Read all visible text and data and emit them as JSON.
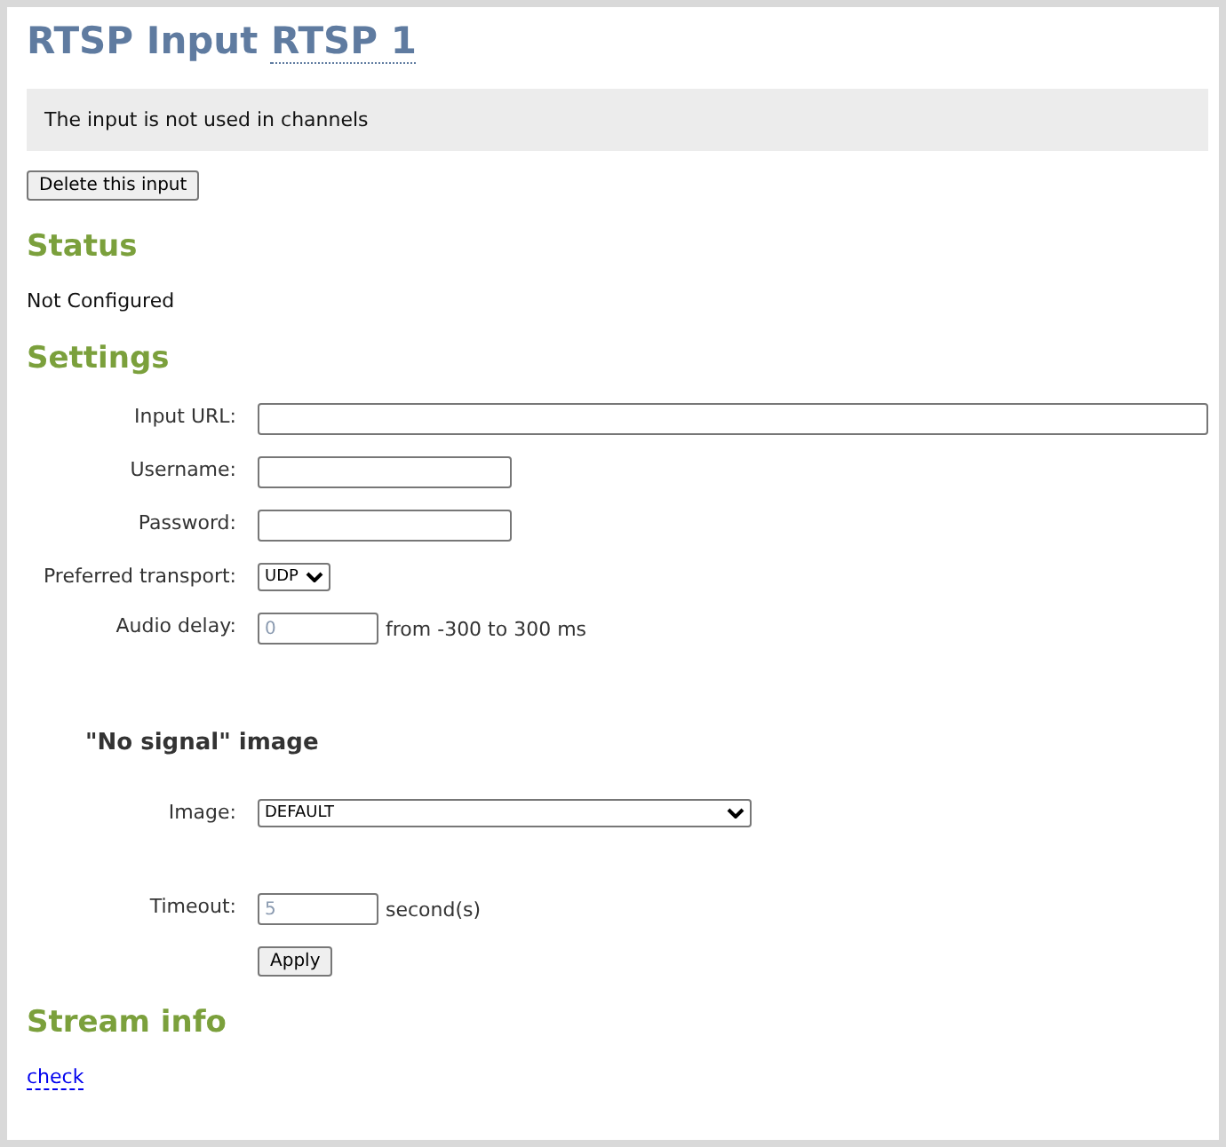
{
  "title": {
    "text": "RTSP Input",
    "name": "RTSP 1"
  },
  "notice": "The input is not used in channels",
  "delete_button": "Delete this input",
  "status": {
    "heading": "Status",
    "value": "Not Configured"
  },
  "settings": {
    "heading": "Settings",
    "fields": [
      {
        "kind": "text",
        "label": "Input URL:"
      },
      {
        "kind": "text",
        "label": "Username:"
      },
      {
        "kind": "password",
        "label": "Password:"
      },
      {
        "kind": "select",
        "label": "Preferred transport:",
        "value": "UDP"
      },
      {
        "kind": "text",
        "label": "Audio delay:",
        "placeholder": "0",
        "suffix": "from -300 to 300 ms"
      }
    ]
  },
  "no_signal": {
    "heading": "\"No signal\" image",
    "fields": [
      {
        "kind": "select",
        "label": "Image:",
        "value": "DEFAULT"
      },
      {
        "kind": "text",
        "label": "Timeout:",
        "placeholder": "5",
        "suffix": "second(s)"
      }
    ],
    "apply_button": "Apply"
  },
  "stream_info": {
    "heading": "Stream info",
    "link": "check"
  }
}
